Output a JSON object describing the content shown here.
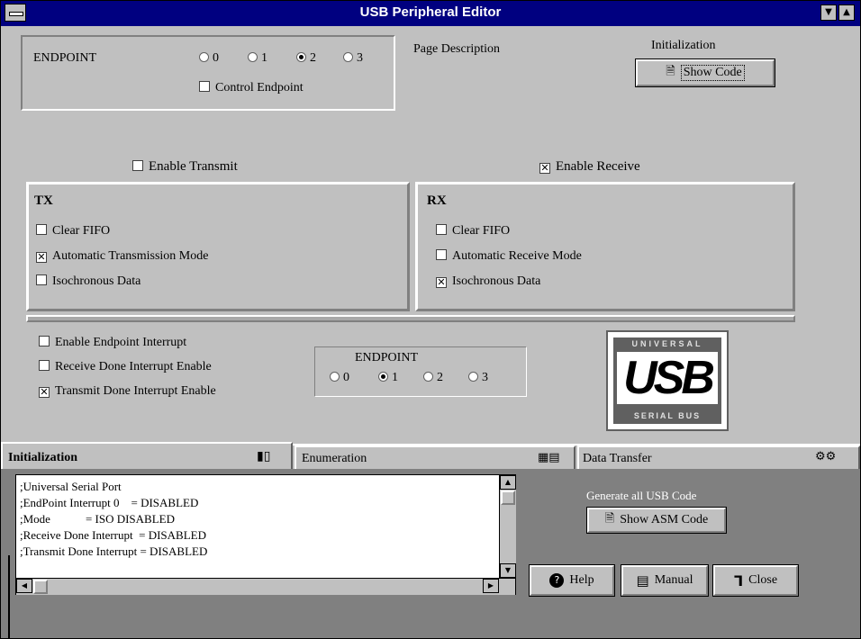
{
  "window": {
    "title": "USB Peripheral Editor"
  },
  "endpoint_group": {
    "label": "ENDPOINT",
    "options": [
      "0",
      "1",
      "2",
      "3"
    ],
    "selected": 2,
    "control_endpoint_label": "Control Endpoint",
    "control_endpoint_checked": false
  },
  "page_description_label": "Page Description",
  "initialization": {
    "label": "Initialization",
    "show_code_label": "Show Code"
  },
  "enable_transmit": {
    "label": "Enable Transmit",
    "checked": false
  },
  "enable_receive": {
    "label": "Enable Receive",
    "checked": true
  },
  "tx": {
    "title": "TX",
    "items": [
      {
        "label": "Clear FIFO",
        "checked": false
      },
      {
        "label": "Automatic Transmission Mode",
        "checked": true
      },
      {
        "label": "Isochronous Data",
        "checked": false
      }
    ]
  },
  "rx": {
    "title": "RX",
    "items": [
      {
        "label": "Clear FIFO",
        "checked": false
      },
      {
        "label": "Automatic Receive Mode",
        "checked": false
      },
      {
        "label": "Isochronous Data",
        "checked": true
      }
    ]
  },
  "interrupts": [
    {
      "label": "Enable Endpoint Interrupt",
      "checked": false
    },
    {
      "label": "Receive Done Interrupt Enable",
      "checked": false
    },
    {
      "label": "Transmit Done Interrupt Enable",
      "checked": true
    }
  ],
  "interrupt_endpoint": {
    "label": "ENDPOINT",
    "options": [
      "0",
      "1",
      "2",
      "3"
    ],
    "selected": 1
  },
  "usb_logo": {
    "top_text": "UNIVERSAL",
    "main_text": "USB",
    "bottom_text": "SERIAL BUS"
  },
  "tabs": [
    {
      "label": "Initialization",
      "active": true
    },
    {
      "label": "Enumeration",
      "active": false
    },
    {
      "label": "Data Transfer",
      "active": false
    }
  ],
  "code_lines": [
    ";Universal Serial Port",
    ";EndPoint Interrupt 0    = DISABLED",
    ";Mode            = ISO DISABLED",
    ";Receive Done Interrupt  = DISABLED",
    ";Transmit Done Interrupt = DISABLED"
  ],
  "generate": {
    "label": "Generate all USB Code",
    "button_label": "Show ASM Code"
  },
  "buttons": {
    "help": "Help",
    "manual": "Manual",
    "close": "Close"
  },
  "colors": {
    "titlebar": "#000080",
    "face": "#c0c0c0",
    "lower_panel": "#808080"
  }
}
